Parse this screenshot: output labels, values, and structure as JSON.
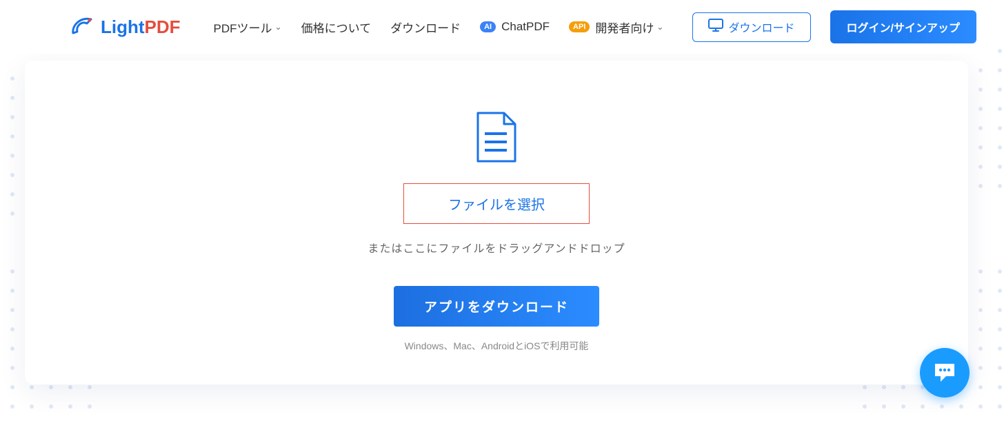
{
  "brand": {
    "light": "Light",
    "pdf": "PDF"
  },
  "nav": {
    "tools": "PDFツール",
    "pricing": "価格について",
    "download": "ダウンロード",
    "chatpdf": "ChatPDF",
    "developers": "開発者向け",
    "ai_badge": "AI",
    "api_badge": "API"
  },
  "header_buttons": {
    "download": "ダウンロード",
    "login": "ログイン/サインアップ"
  },
  "main": {
    "select_file": "ファイルを選択",
    "drop_hint": "またはここにファイルをドラッグアンドドロップ",
    "download_app": "アプリをダウンロード",
    "platforms": "Windows、Mac、AndroidとiOSで利用可能"
  },
  "colors": {
    "primary": "#1a73e8",
    "accent": "#e74c3c",
    "chat": "#1a9cff"
  }
}
